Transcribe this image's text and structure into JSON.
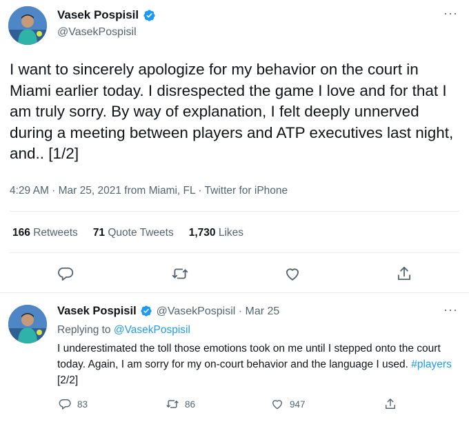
{
  "main_tweet": {
    "display_name": "Vasek Pospisil",
    "handle": "@VasekPospisil",
    "text": "I want to sincerely apologize for my behavior on the court in Miami earlier today. I disrespected the game I love and for that I am truly sorry. By way of explanation, I felt deeply unnerved during a meeting between players and ATP executives last night, and.. [1/2]",
    "meta": "4:29 AM · Mar 25, 2021 from Miami, FL · Twitter for iPhone",
    "stats": {
      "retweets_count": "166",
      "retweets_label": "Retweets",
      "quote_count": "71",
      "quote_label": "Quote Tweets",
      "likes_count": "1,730",
      "likes_label": "Likes"
    },
    "more_label": "···"
  },
  "reply_tweet": {
    "display_name": "Vasek Pospisil",
    "handle_date": "@VasekPospisil · Mar 25",
    "replying_prefix": "Replying to",
    "replying_to": "@VasekPospisil",
    "text_before": "I underestimated the toll those emotions took on me until I stepped onto the court today. Again, I am sorry for my on-court behavior and the language I used. ",
    "hashtag": "#players",
    "text_after": " [2/2]",
    "reply_count": "83",
    "retweet_count": "86",
    "like_count": "947",
    "more_label": "···"
  },
  "icons": {
    "verified": "verified-badge-icon",
    "reply": "reply-bubble-icon",
    "retweet": "retweet-icon",
    "like": "heart-icon",
    "share": "share-icon",
    "more": "more-dots-icon"
  },
  "colors": {
    "text": "#0f1419",
    "secondary": "#536471",
    "accent": "#1d9bf0",
    "divider": "#e6ecf0"
  }
}
